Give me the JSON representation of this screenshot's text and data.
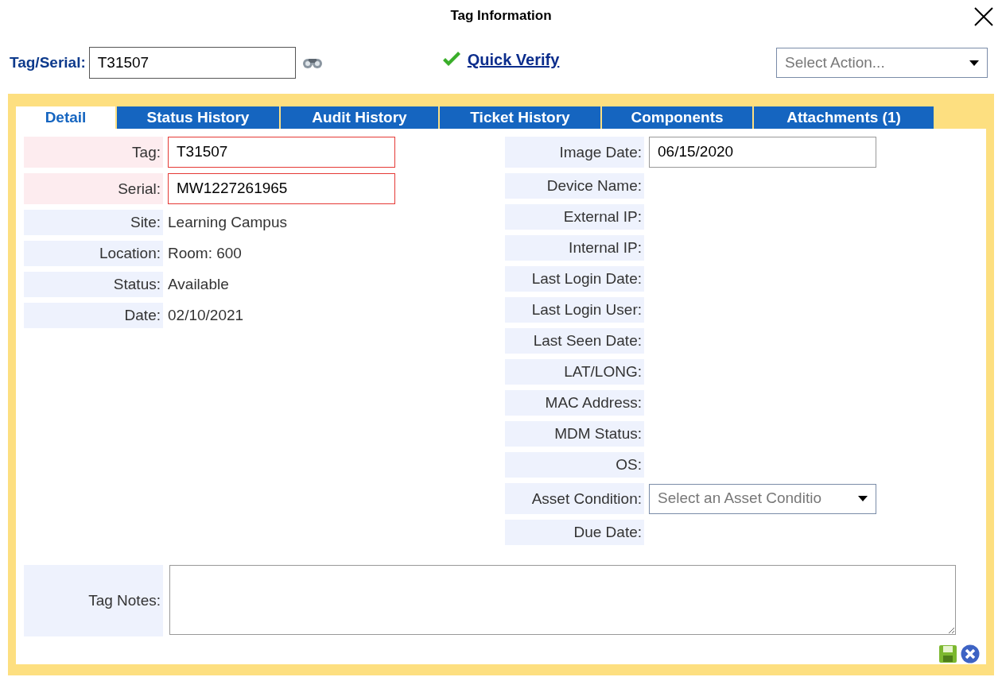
{
  "window": {
    "title": "Tag Information"
  },
  "lookup": {
    "label": "Tag/Serial:",
    "value": "T31507"
  },
  "quick_verify": {
    "label": "Quick Verify"
  },
  "action_select": {
    "placeholder": "Select Action..."
  },
  "tabs": [
    {
      "label": "Detail",
      "selected": true
    },
    {
      "label": "Status History",
      "selected": false
    },
    {
      "label": "Audit History",
      "selected": false
    },
    {
      "label": "Ticket History",
      "selected": false
    },
    {
      "label": "Components",
      "selected": false
    },
    {
      "label": "Attachments (1)",
      "selected": false
    }
  ],
  "left_fields": [
    {
      "label": "Tag:",
      "kind": "input",
      "value": "T31507",
      "invalid": true
    },
    {
      "label": "Serial:",
      "kind": "input",
      "value": "MW1227261965",
      "invalid": true
    },
    {
      "label": "Site:",
      "kind": "text",
      "value": "Learning Campus",
      "invalid": false
    },
    {
      "label": "Location:",
      "kind": "text",
      "value": "Room: 600",
      "invalid": false
    },
    {
      "label": "Status:",
      "kind": "text",
      "value": "Available",
      "invalid": false
    },
    {
      "label": "Date:",
      "kind": "text",
      "value": "02/10/2021",
      "invalid": false
    }
  ],
  "right_fields": [
    {
      "label": "Image Date:",
      "kind": "input",
      "value": "06/15/2020"
    },
    {
      "label": "Device Name:",
      "kind": "text"
    },
    {
      "label": "External IP:",
      "kind": "text"
    },
    {
      "label": "Internal IP:",
      "kind": "text"
    },
    {
      "label": "Last Login Date:",
      "kind": "text"
    },
    {
      "label": "Last Login User:",
      "kind": "text"
    },
    {
      "label": "Last Seen Date:",
      "kind": "text"
    },
    {
      "label": "LAT/LONG:",
      "kind": "text"
    },
    {
      "label": "MAC Address:",
      "kind": "text"
    },
    {
      "label": "MDM Status:",
      "kind": "text"
    },
    {
      "label": "OS:",
      "kind": "text"
    },
    {
      "label": "Asset Condition:",
      "kind": "select",
      "placeholder": "Select an Asset Conditio"
    },
    {
      "label": "Due Date:",
      "kind": "text"
    }
  ],
  "notes": {
    "label": "Tag Notes:"
  }
}
